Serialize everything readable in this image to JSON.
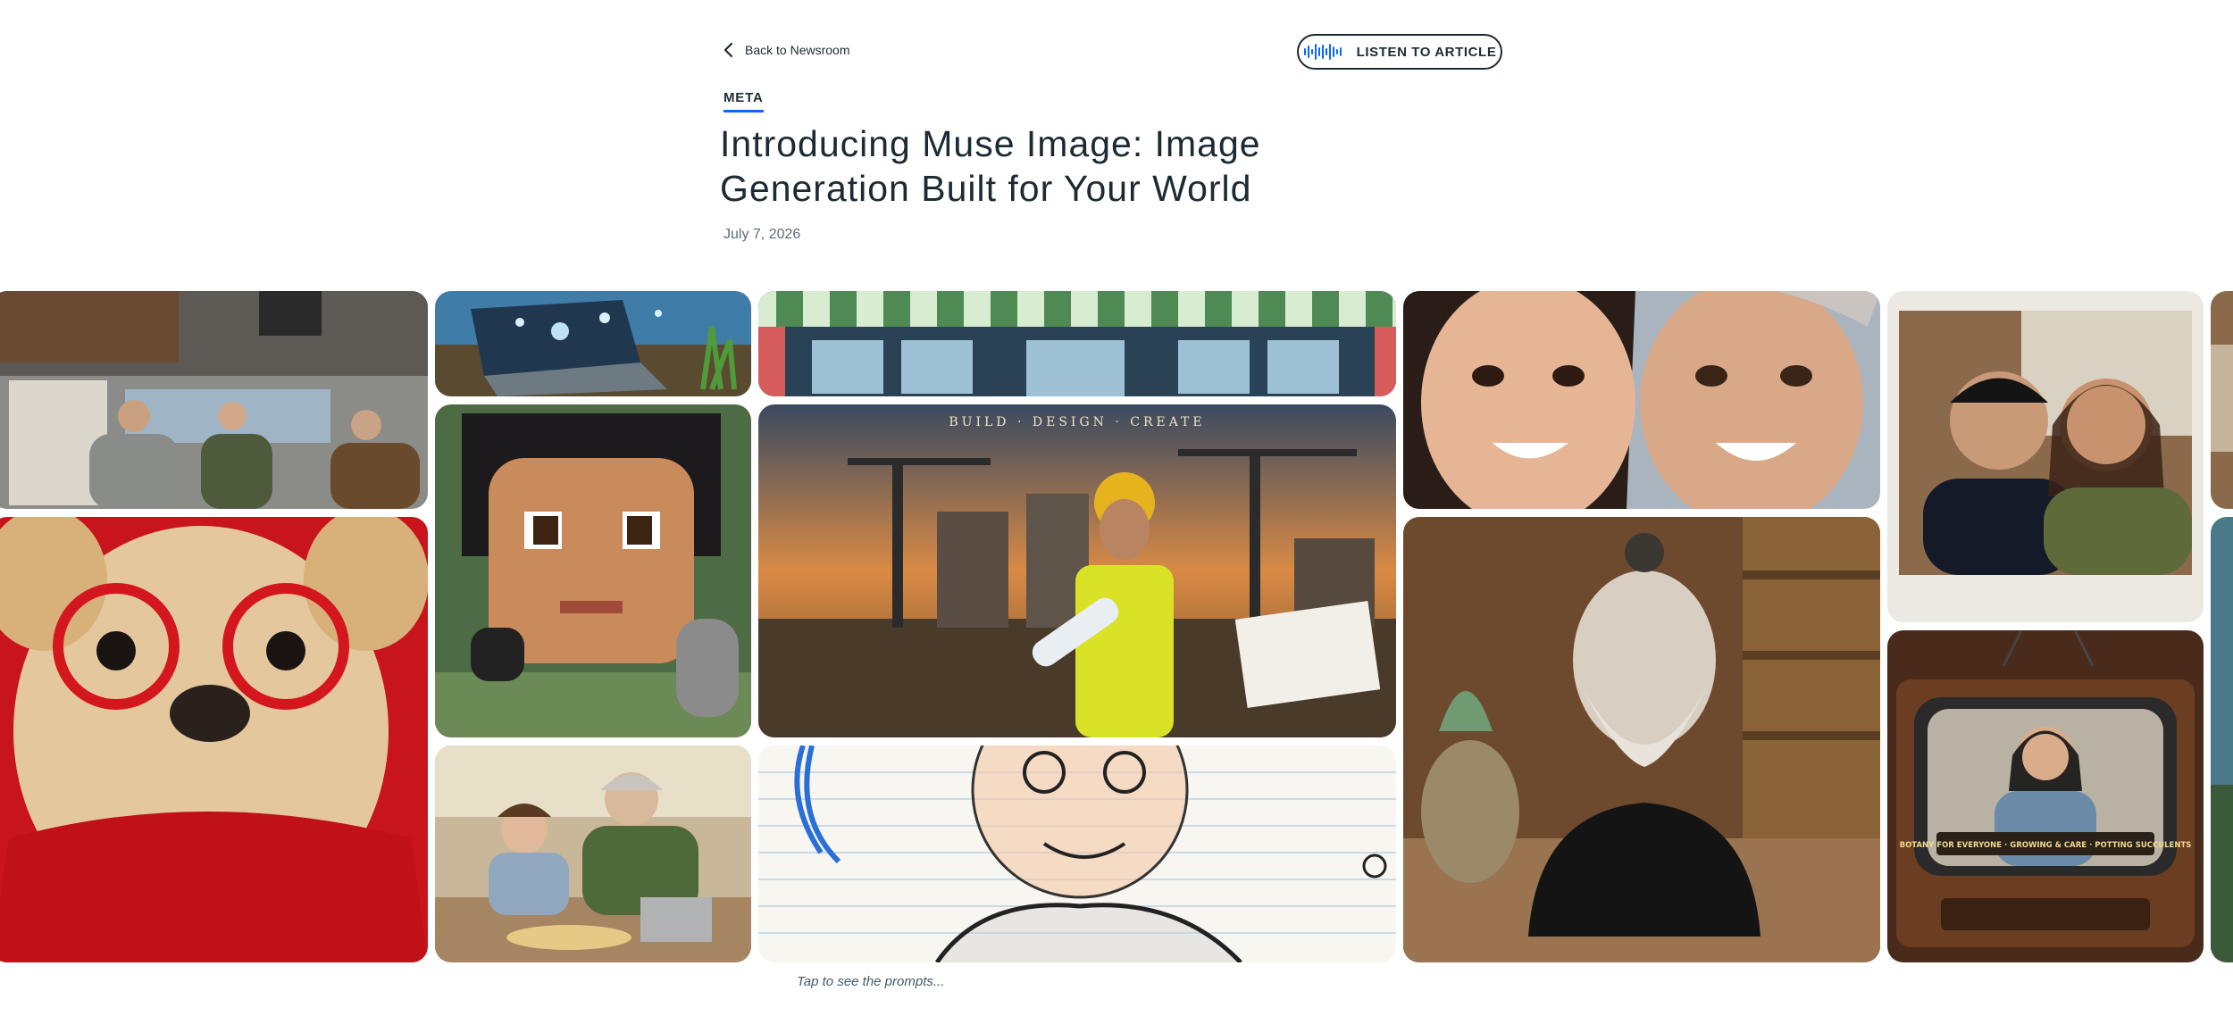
{
  "nav": {
    "back_label": "Back to Newsroom"
  },
  "audio": {
    "listen_label": "LISTEN TO ARTICLE"
  },
  "article": {
    "tag": "META",
    "title": "Introducing Muse Image: Image Generation Built for Your World",
    "date": "July 7, 2026"
  },
  "gallery": {
    "hint": "Tap to see the prompts...",
    "images": {
      "office_overhead": {
        "name": "Three people looking up at hanging objects in an office"
      },
      "laptop_splash": {
        "name": "Laptop splashed with water on soil"
      },
      "storefront": {
        "name": "Storefront with green striped awning"
      },
      "selfie_duo": {
        "name": "Two smiling women cheek to cheek"
      },
      "couple_kitchen": {
        "name": "Smiling couple in a kitchen, instant photo"
      },
      "pixel_girl": {
        "name": "Pixel art girl with headphones and microphone"
      },
      "architect_poster": {
        "name": "Construction worker with blueprints at sunset",
        "text": "BUILD · DESIGN · CREATE"
      },
      "ceramic_bust": {
        "name": "Glazed ceramic bust of a bearded man"
      },
      "dog_glasses": {
        "name": "Chihuahua with red glasses and red sweater"
      },
      "pasta_family": {
        "name": "Grandmother and child making pasta"
      },
      "crayon_sketch": {
        "name": "Crayon sketch of a boy on notebook paper"
      },
      "retro_tv": {
        "name": "Retro TV showing a woman potting a succulent",
        "caption": "BOTANY FOR EVERYONE · GROWING & CARE · POTTING SUCCULENTS"
      }
    }
  },
  "colors": {
    "text": "#1c2b33",
    "accent": "#0866ff",
    "muted": "#5d6c7b"
  }
}
